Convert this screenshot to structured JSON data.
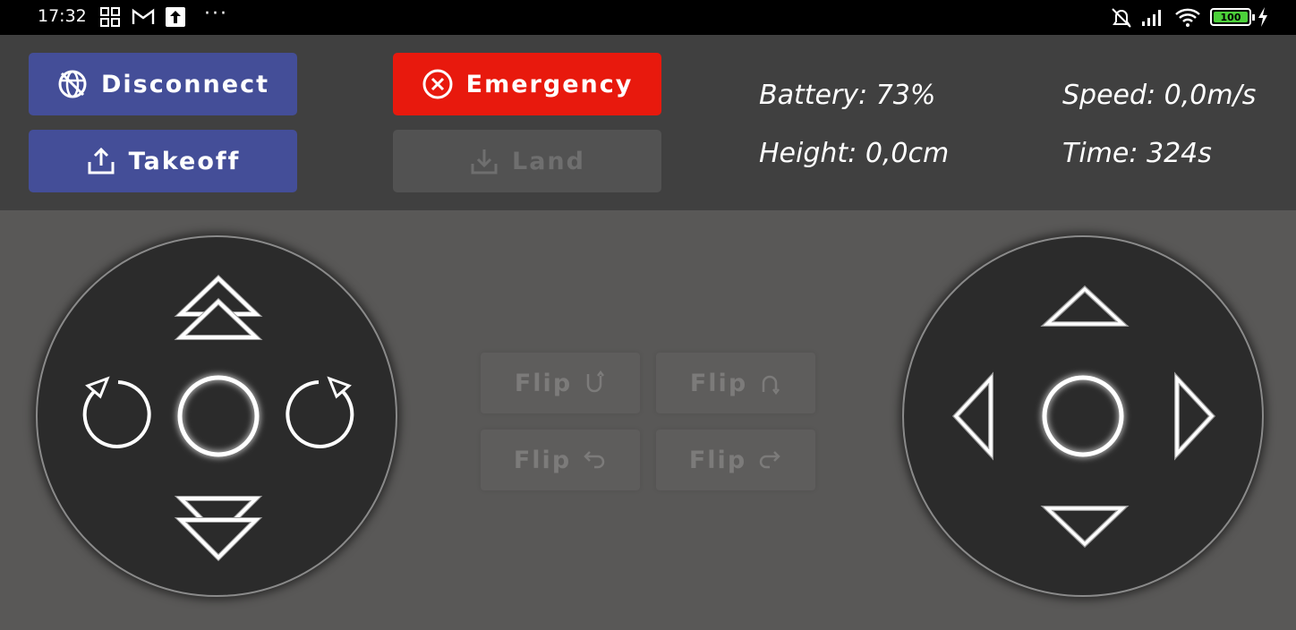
{
  "status_bar": {
    "time": "17:32",
    "icons": [
      "grid-apps-icon",
      "gmail-icon",
      "upload-notification-icon",
      "more-dots-icon",
      "alarm-off-icon",
      "signal-icon",
      "wifi-icon",
      "battery-icon",
      "charging-icon"
    ],
    "more": "···",
    "battery_level": "100"
  },
  "controls": {
    "disconnect_label": "Disconnect",
    "takeoff_label": "Takeoff",
    "emergency_label": "Emergency",
    "land_label": "Land"
  },
  "telemetry": {
    "battery": "Battery: 73%",
    "speed": "Speed: 0,0m/s",
    "height": "Height: 0,0cm",
    "time": "Time: 324s"
  },
  "flips": {
    "forward": "Flip",
    "back": "Flip",
    "left": "Flip",
    "right": "Flip"
  },
  "colors": {
    "button_blue": "#444e98",
    "button_red": "#e8190d",
    "panel": "#404040",
    "background": "#595857",
    "joystick": "#2b2b2b"
  }
}
